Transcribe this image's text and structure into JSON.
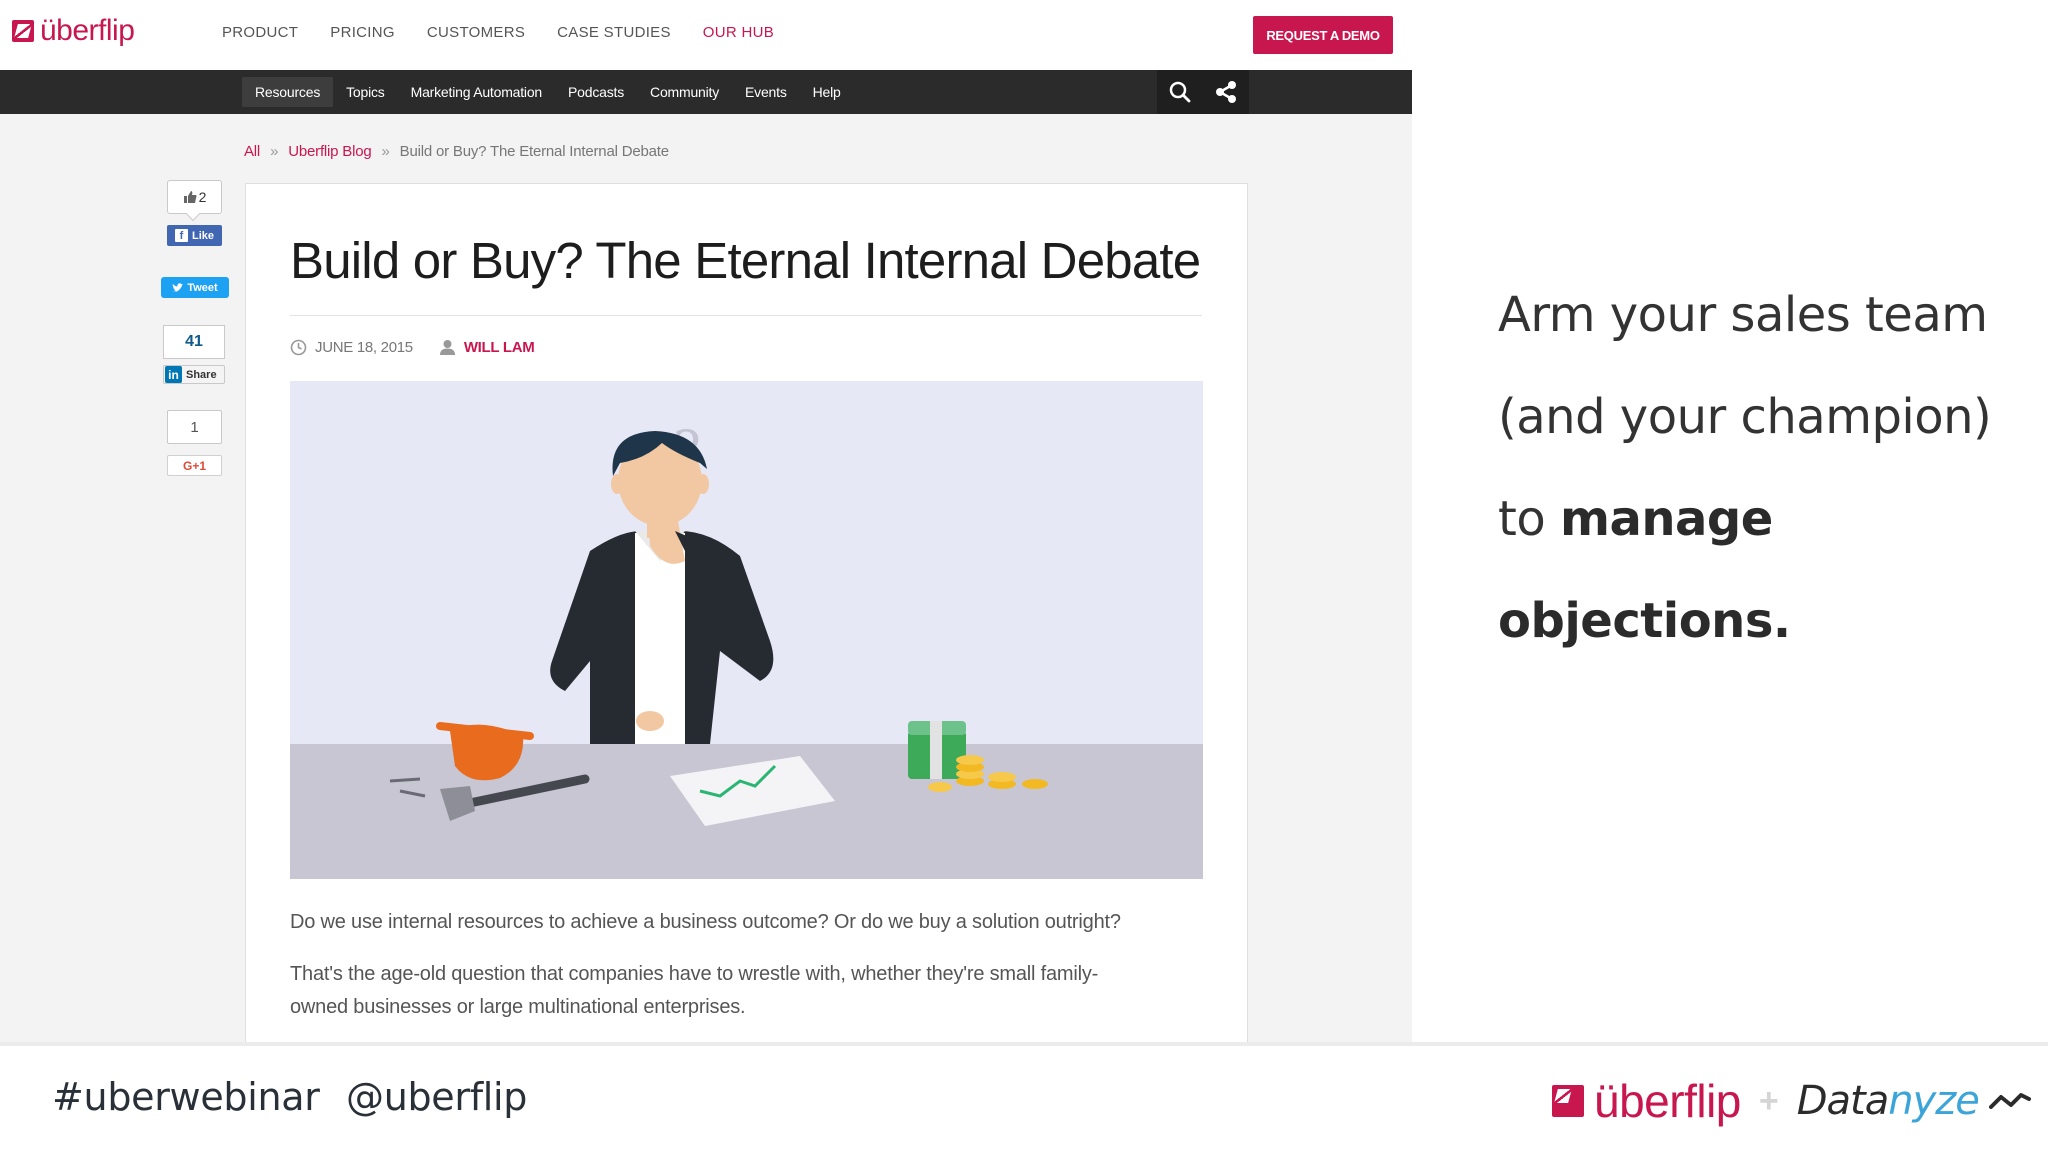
{
  "site": {
    "logo_text": "überflip",
    "nav": [
      "PRODUCT",
      "PRICING",
      "CUSTOMERS",
      "CASE STUDIES",
      "OUR HUB"
    ],
    "cta": "REQUEST A DEMO",
    "subnav": [
      "Resources",
      "Topics",
      "Marketing Automation",
      "Podcasts",
      "Community",
      "Events",
      "Help"
    ],
    "subnav_active": "Resources"
  },
  "breadcrumb": {
    "all": "All",
    "sep": "»",
    "blog": "Uberflip Blog",
    "current": "Build or Buy? The Eternal Internal Debate"
  },
  "social": {
    "fb_count": "2",
    "fb_label": "Like",
    "tweet_label": "Tweet",
    "li_count": "41",
    "li_label": "Share",
    "gp_count": "1",
    "gp_label": "G+1"
  },
  "article": {
    "title": "Build or Buy? The Eternal Internal Debate",
    "date": "JUNE 18, 2015",
    "author": "WILL LAM",
    "para1": "Do we use internal resources to achieve a business outcome? Or do we buy a solution outright?",
    "para2_line1": "That's the age-old question that companies have to wrestle with, whether they're small family-",
    "para2_line2": "owned businesses or large multinational enterprises."
  },
  "slide": {
    "line1": "Arm your sales team",
    "line2": "(and your champion)",
    "line3_prefix": "to",
    "line3_bold": "manage",
    "line4_bold": "objections."
  },
  "footer": {
    "hashtag": "#uberwebinar",
    "handle": "@uberflip",
    "logo_uberflip": "überflip",
    "plus": "+",
    "logo_datanyze_dark": "Data",
    "logo_datanyze_blue": "nyze"
  },
  "colors": {
    "brand": "#c8174f",
    "nav_dark": "#2b2b2b",
    "facebook": "#4267b2",
    "twitter": "#1da1f2",
    "linkedin": "#0077b5",
    "datanyze_blue": "#3ba4d8"
  },
  "icons": [
    "search-icon",
    "share-icon",
    "clock-icon",
    "user-icon",
    "thumbs-up-icon",
    "question-mark-icon"
  ]
}
